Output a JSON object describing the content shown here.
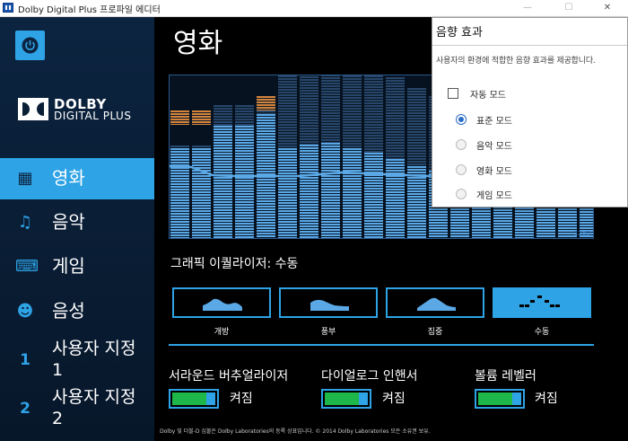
{
  "window": {
    "title": "Dolby Digital Plus 프로파일 에디터",
    "minimize": "—",
    "maximize": "☐",
    "close": "✕"
  },
  "brand": {
    "name": "DOLBY",
    "product": "DIGITAL PLUS"
  },
  "sidebar": {
    "items": [
      {
        "label": "영화",
        "icon": "film-icon",
        "glyph": "▦"
      },
      {
        "label": "음악",
        "icon": "music-note-icon",
        "glyph": "♫"
      },
      {
        "label": "게임",
        "icon": "gamepad-icon",
        "glyph": "⌨"
      },
      {
        "label": "음성",
        "icon": "voice-icon",
        "glyph": "☻"
      },
      {
        "label": "사용자 지정 1",
        "icon": "number-1-icon",
        "glyph": "1"
      },
      {
        "label": "사용자 지정 2",
        "icon": "number-2-icon",
        "glyph": "2"
      }
    ]
  },
  "main": {
    "title": "영화",
    "equalizer": {
      "db_label": "12dB"
    },
    "eq_title": "그래픽 이퀄라이저: 수동",
    "presets": [
      {
        "label": "개방"
      },
      {
        "label": "풍부"
      },
      {
        "label": "집중"
      },
      {
        "label": "수동"
      }
    ],
    "features": [
      {
        "label": "서라운드 버추얼라이저",
        "state": "켜짐"
      },
      {
        "label": "다이얼로그 인핸서",
        "state": "켜짐"
      },
      {
        "label": "볼륨 레벨러",
        "state": "켜짐"
      }
    ],
    "footer": "Dolby 및 더블-D 심볼은 Dolby Laboratories의 등록 상표입니다. © 2014 Dolby Laboratories 모든 소유권 보유."
  },
  "popup": {
    "title": "음향 효과",
    "description": "사용자의 환경에 적합한 음향 효과를 제공합니다.",
    "auto_mode": "자동 모드",
    "modes": [
      "표준 모드",
      "음악 모드",
      "영화 모드",
      "게임 모드"
    ],
    "selected_mode": "표준 모드"
  },
  "colors": {
    "accent": "#2ea3e6",
    "sidebar": "#0c2440",
    "toggle_on": "#1eb84a",
    "eq_peak": "#d4843a"
  }
}
